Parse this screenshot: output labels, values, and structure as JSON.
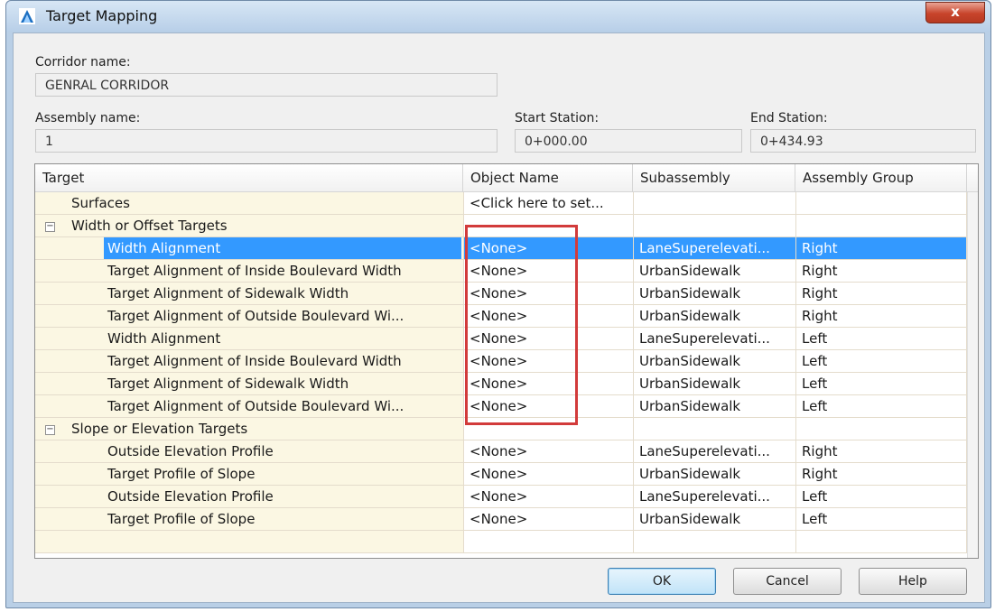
{
  "window": {
    "title": "Target Mapping",
    "close_label": "x"
  },
  "corridor": {
    "label": "Corridor name:",
    "value": "GENRAL CORRIDOR"
  },
  "assembly": {
    "label": "Assembly name:",
    "value": "1"
  },
  "start_station": {
    "label": "Start Station:",
    "value": "0+000.00"
  },
  "end_station": {
    "label": "End Station:",
    "value": "0+434.93"
  },
  "grid": {
    "headers": {
      "target": "Target",
      "object": "Object Name",
      "subassembly": "Subassembly",
      "group": "Assembly Group"
    },
    "rows": [
      {
        "target": "Surfaces",
        "object": "<Click here to set...",
        "sub": "",
        "group": ""
      },
      {
        "target": "Width or Offset Targets",
        "object": "",
        "sub": "",
        "group": ""
      },
      {
        "target": "Width Alignment",
        "object": "<None>",
        "sub": "LaneSuperelevati...",
        "group": "Right"
      },
      {
        "target": "Target Alignment of Inside Boulevard Width",
        "object": "<None>",
        "sub": "UrbanSidewalk",
        "group": "Right"
      },
      {
        "target": "Target Alignment of Sidewalk Width",
        "object": "<None>",
        "sub": "UrbanSidewalk",
        "group": "Right"
      },
      {
        "target": "Target Alignment of Outside Boulevard Wi...",
        "object": "<None>",
        "sub": "UrbanSidewalk",
        "group": "Right"
      },
      {
        "target": "Width Alignment",
        "object": "<None>",
        "sub": "LaneSuperelevati...",
        "group": "Left"
      },
      {
        "target": "Target Alignment of Inside Boulevard Width",
        "object": "<None>",
        "sub": "UrbanSidewalk",
        "group": "Left"
      },
      {
        "target": "Target Alignment of Sidewalk Width",
        "object": "<None>",
        "sub": "UrbanSidewalk",
        "group": "Left"
      },
      {
        "target": "Target Alignment of Outside Boulevard Wi...",
        "object": "<None>",
        "sub": "UrbanSidewalk",
        "group": "Left"
      },
      {
        "target": "Slope or Elevation Targets",
        "object": "",
        "sub": "",
        "group": ""
      },
      {
        "target": "Outside Elevation Profile",
        "object": "<None>",
        "sub": "LaneSuperelevati...",
        "group": "Right"
      },
      {
        "target": "Target Profile of Slope",
        "object": "<None>",
        "sub": "UrbanSidewalk",
        "group": "Right"
      },
      {
        "target": "Outside Elevation Profile",
        "object": "<None>",
        "sub": "LaneSuperelevati...",
        "group": "Left"
      },
      {
        "target": "Target Profile of Slope",
        "object": "<None>",
        "sub": "UrbanSidewalk",
        "group": "Left"
      }
    ]
  },
  "buttons": {
    "ok": "OK",
    "cancel": "Cancel",
    "help": "Help"
  },
  "colors": {
    "selection": "#3399ff",
    "highlight": "#d23b3b",
    "tree_bg": "#fbf7e3"
  },
  "icons": {
    "app": "civil3d-app-icon",
    "close": "close-icon"
  }
}
